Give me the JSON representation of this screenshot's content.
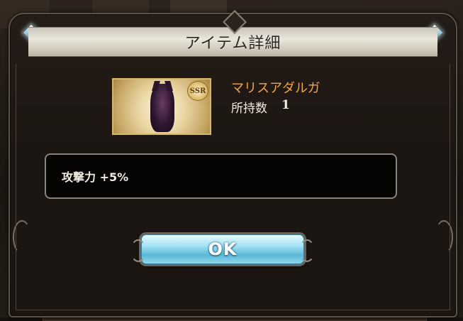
{
  "dialog": {
    "title": "アイテム詳細",
    "ok_label": "OK"
  },
  "item": {
    "name": "マリスアダルガ",
    "rarity_badge": "SSR",
    "count_label": "所持数",
    "count_value": "1",
    "effect": "攻撃力 +5%"
  },
  "colors": {
    "item_name": "#f0a44e",
    "ok_button": "#9fe0f4",
    "title_bar": "#ece7dc"
  },
  "icons": [
    "gem-icon",
    "gem-icon",
    "ssr-badge-icon"
  ]
}
